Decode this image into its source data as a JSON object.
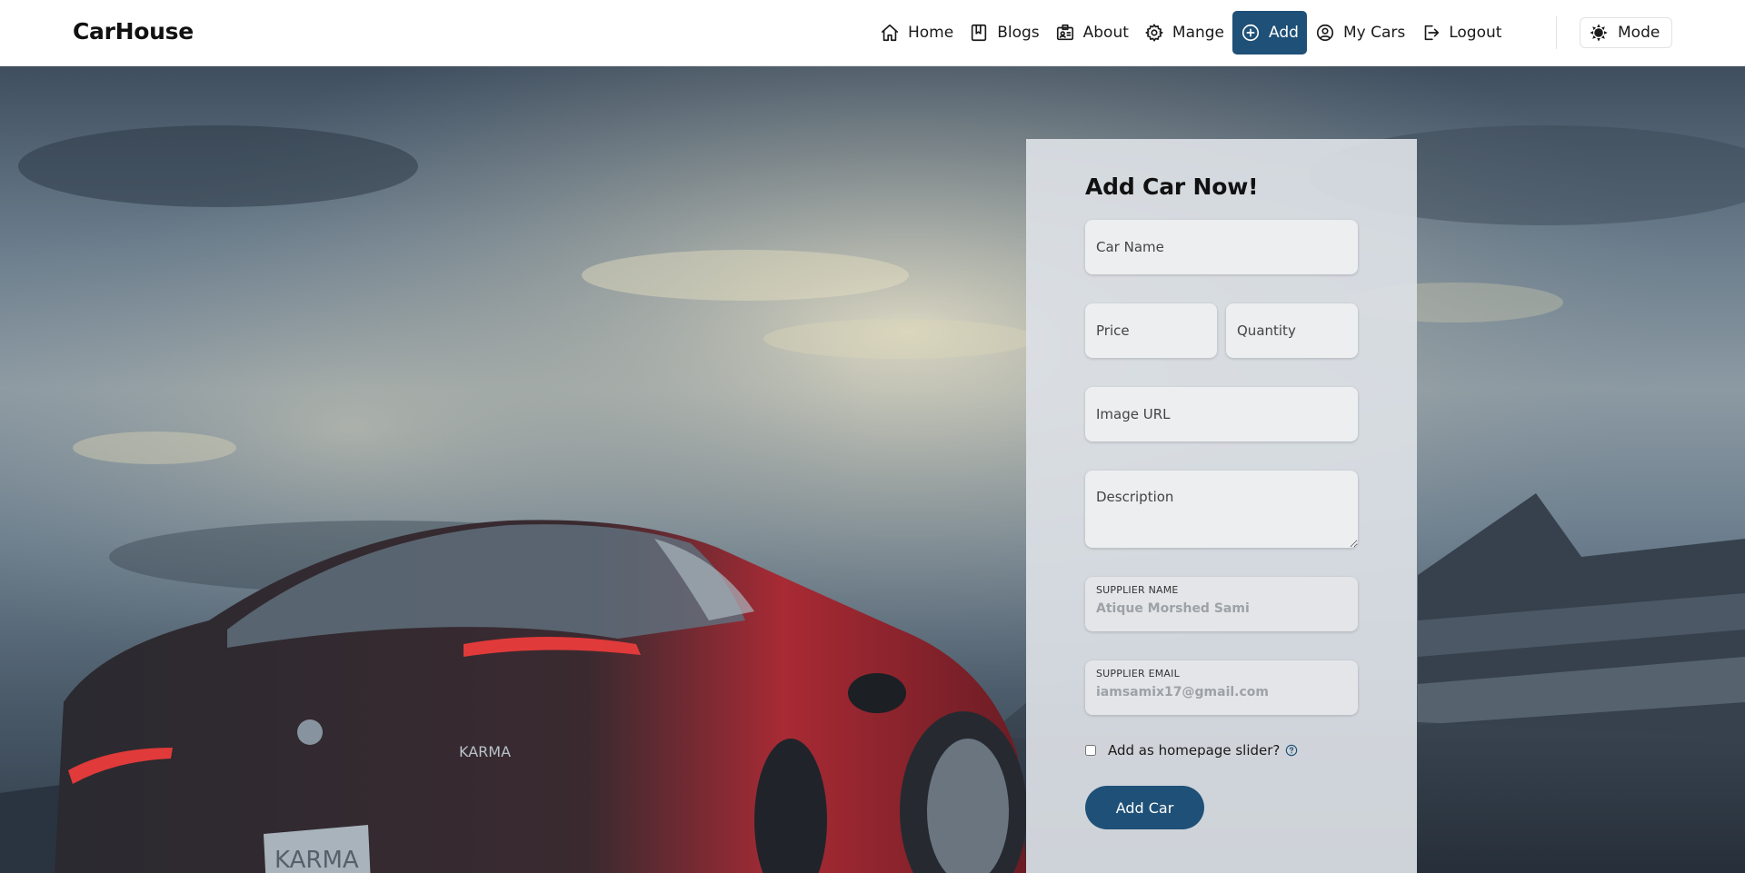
{
  "brand": "CarHouse",
  "nav": {
    "items": [
      {
        "label": "Home",
        "icon": "home-icon"
      },
      {
        "label": "Blogs",
        "icon": "book-icon"
      },
      {
        "label": "About",
        "icon": "id-card-icon"
      },
      {
        "label": "Mange",
        "icon": "gear-icon"
      },
      {
        "label": "Add",
        "icon": "plus-circle-icon",
        "active": true
      },
      {
        "label": "My Cars",
        "icon": "user-circle-icon"
      },
      {
        "label": "Logout",
        "icon": "logout-icon"
      }
    ],
    "mode_label": "Mode",
    "active_color": "#1f5077"
  },
  "form": {
    "title": "Add Car Now!",
    "car_name_placeholder": "Car Name",
    "price_placeholder": "Price",
    "quantity_placeholder": "Quantity",
    "image_url_placeholder": "Image URL",
    "description_placeholder": "Description",
    "supplier_name_label": "SUPPLIER NAME",
    "supplier_name_value": "Atique Morshed Sami",
    "supplier_email_label": "SUPPLIER EMAIL",
    "supplier_email_value": "iamsamix17@gmail.com",
    "slider_checkbox_label": "Add as homepage slider?",
    "submit_label": "Add Car"
  },
  "hero": {
    "car_badge_text": "KARMA",
    "plate_text": "KARMA"
  }
}
